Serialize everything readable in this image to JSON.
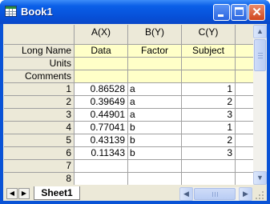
{
  "window": {
    "title": "Book1"
  },
  "columns": [
    {
      "header": "A(X)",
      "long_name": "Data",
      "units": "",
      "comments": ""
    },
    {
      "header": "B(Y)",
      "long_name": "Factor",
      "units": "",
      "comments": ""
    },
    {
      "header": "C(Y)",
      "long_name": "Subject",
      "units": "",
      "comments": ""
    }
  ],
  "label_rows": [
    "Long Name",
    "Units",
    "Comments"
  ],
  "rows": [
    {
      "num": "1",
      "a": "0.86528",
      "b": "a",
      "c": "1"
    },
    {
      "num": "2",
      "a": "0.39649",
      "b": "a",
      "c": "2"
    },
    {
      "num": "3",
      "a": "0.44901",
      "b": "a",
      "c": "3"
    },
    {
      "num": "4",
      "a": "0.77041",
      "b": "b",
      "c": "1"
    },
    {
      "num": "5",
      "a": "0.43139",
      "b": "b",
      "c": "2"
    },
    {
      "num": "6",
      "a": "0.11343",
      "b": "b",
      "c": "3"
    },
    {
      "num": "7",
      "a": "",
      "b": "",
      "c": ""
    },
    {
      "num": "8",
      "a": "",
      "b": "",
      "c": ""
    }
  ],
  "sheet_tab": "Sheet1",
  "icons": {
    "app": "worksheet-icon",
    "minimize": "minimize-icon",
    "maximize": "maximize-icon",
    "close": "close-icon"
  },
  "colors": {
    "titlebar": "#0a53d6",
    "label_row_bg": "#ffffc8",
    "header_bg": "#ece9d8",
    "close_button": "#d0461e"
  }
}
